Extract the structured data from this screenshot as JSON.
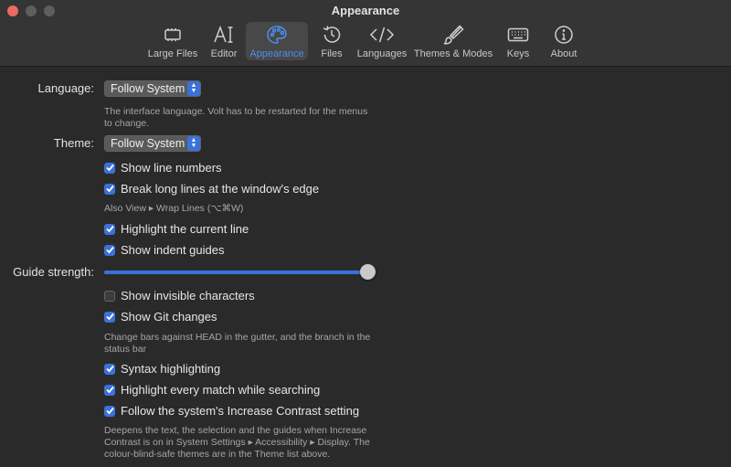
{
  "window": {
    "title": "Appearance"
  },
  "toolbar": {
    "tabs": [
      {
        "label": "Large Files",
        "icon": "chip-icon"
      },
      {
        "label": "Editor",
        "icon": "text-cursor-icon"
      },
      {
        "label": "Appearance",
        "icon": "palette-icon",
        "active": true
      },
      {
        "label": "Files",
        "icon": "history-icon"
      },
      {
        "label": "Languages",
        "icon": "code-brackets-icon"
      },
      {
        "label": "Themes & Modes",
        "icon": "brush-icon"
      },
      {
        "label": "Keys",
        "icon": "keyboard-icon"
      },
      {
        "label": "About",
        "icon": "info-icon"
      }
    ]
  },
  "settings": {
    "language": {
      "label": "Language:",
      "value": "Follow System",
      "note_line1": "The interface language. Volt has to be restarted for the menus",
      "note_line2": "to change."
    },
    "theme": {
      "label": "Theme:",
      "value": "Follow System"
    },
    "show_line_numbers": {
      "label": "Show line numbers",
      "checked": true
    },
    "break_long_lines": {
      "label": "Break long lines at the window's edge",
      "checked": true,
      "note": "Also View ▸ Wrap Lines (⌥⌘W)"
    },
    "highlight_current_line": {
      "label": "Highlight the current line",
      "checked": true
    },
    "show_indent_guides": {
      "label": "Show indent guides",
      "checked": true
    },
    "guide_strength": {
      "label": "Guide strength:",
      "value": 1.0
    },
    "show_invisible": {
      "label": "Show invisible characters",
      "checked": false
    },
    "show_git_changes": {
      "label": "Show Git changes",
      "checked": true,
      "note_line1": "Change bars against HEAD in the gutter, and the branch in the",
      "note_line2": "status bar"
    },
    "syntax_highlighting": {
      "label": "Syntax highlighting",
      "checked": true
    },
    "highlight_every_match": {
      "label": "Highlight every match while searching",
      "checked": true
    },
    "increase_contrast": {
      "label": "Follow the system's Increase Contrast setting",
      "checked": true,
      "note_line1": "Deepens the text, the selection and the guides when Increase",
      "note_line2": "Contrast is on in System Settings ▸ Accessibility ▸ Display. The",
      "note_line3": "colour-blind-safe themes are in the Theme list above."
    }
  },
  "colors": {
    "accent": "#3a72d9",
    "active_tab": "#4e8ef7",
    "close_button": "#ec6a5e"
  }
}
